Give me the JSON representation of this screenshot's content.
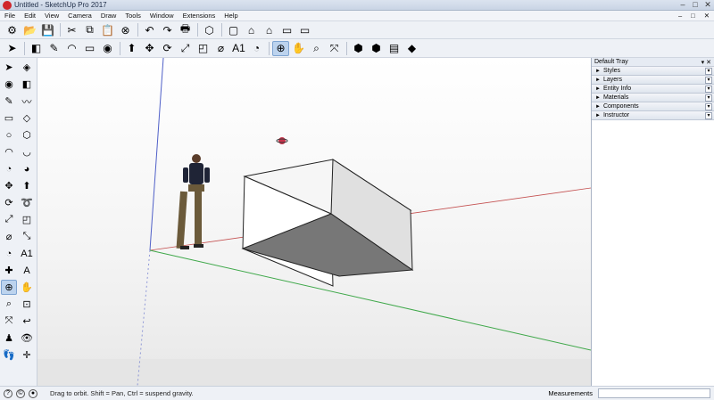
{
  "window": {
    "title": "Untitled - SketchUp Pro 2017",
    "minimize": "–",
    "maximize": "□",
    "close": "✕"
  },
  "menu": [
    "File",
    "Edit",
    "View",
    "Camera",
    "Draw",
    "Tools",
    "Window",
    "Extensions",
    "Help"
  ],
  "menu_right": [
    "–",
    "□",
    "✕"
  ],
  "toolbar1": [
    {
      "name": "getting-started-icon",
      "glyph": "⚙"
    },
    {
      "name": "open-icon",
      "glyph": "📂"
    },
    {
      "name": "save-icon",
      "glyph": "💾"
    },
    {
      "name": "cut-icon",
      "glyph": "✂"
    },
    {
      "name": "copy-icon",
      "glyph": "⧉"
    },
    {
      "name": "paste-icon",
      "glyph": "📋"
    },
    {
      "name": "erase-icon",
      "glyph": "⊗"
    },
    {
      "name": "undo-icon",
      "glyph": "↶"
    },
    {
      "name": "redo-icon",
      "glyph": "↷"
    },
    {
      "name": "print-icon",
      "glyph": "🖶"
    },
    {
      "name": "model-info-icon",
      "glyph": "⬡"
    },
    {
      "name": "iso-view-icon",
      "glyph": "▢"
    },
    {
      "name": "home-icon",
      "glyph": "⌂"
    },
    {
      "name": "front-view-icon",
      "glyph": "⌂"
    },
    {
      "name": "right-view-icon",
      "glyph": "▭"
    },
    {
      "name": "back-view-icon",
      "glyph": "▭"
    }
  ],
  "toolbar2": [
    {
      "name": "select-icon",
      "glyph": "➤"
    },
    {
      "name": "eraser-icon",
      "glyph": "◧"
    },
    {
      "name": "line-icon",
      "glyph": "✎"
    },
    {
      "name": "arc-icon",
      "glyph": "◠"
    },
    {
      "name": "rectangle-icon",
      "glyph": "▭"
    },
    {
      "name": "paint-bucket-icon",
      "glyph": "◉"
    },
    {
      "name": "push-pull-icon",
      "glyph": "⬆"
    },
    {
      "name": "move-icon",
      "glyph": "✥"
    },
    {
      "name": "rotate-icon",
      "glyph": "⟳"
    },
    {
      "name": "scale-icon",
      "glyph": "⤢"
    },
    {
      "name": "offset-icon",
      "glyph": "◰"
    },
    {
      "name": "tape-measure-icon",
      "glyph": "⌀"
    },
    {
      "name": "text-icon",
      "glyph": "A1"
    },
    {
      "name": "protractor-icon",
      "glyph": "◔"
    },
    {
      "name": "orbit-icon",
      "glyph": "⊕"
    },
    {
      "name": "pan-icon",
      "glyph": "✋"
    },
    {
      "name": "zoom-icon",
      "glyph": "⌕"
    },
    {
      "name": "zoom-extents-icon",
      "glyph": "⤧"
    },
    {
      "name": "3d-warehouse-icon",
      "glyph": "⬢"
    },
    {
      "name": "extension-warehouse-icon",
      "glyph": "⬢"
    },
    {
      "name": "layout-icon",
      "glyph": "▤"
    },
    {
      "name": "ruby-console-icon",
      "glyph": "◆"
    }
  ],
  "left_tools": [
    {
      "name": "select-icon",
      "glyph": "➤"
    },
    {
      "name": "make-component-icon",
      "glyph": "◈"
    },
    {
      "name": "paint-bucket-icon",
      "glyph": "◉"
    },
    {
      "name": "eraser-icon",
      "glyph": "◧"
    },
    {
      "name": "line-icon",
      "glyph": "✎"
    },
    {
      "name": "freehand-icon",
      "glyph": "〰"
    },
    {
      "name": "rectangle-icon",
      "glyph": "▭"
    },
    {
      "name": "rotated-rectangle-icon",
      "glyph": "◇"
    },
    {
      "name": "circle-icon",
      "glyph": "○"
    },
    {
      "name": "polygon-icon",
      "glyph": "⬡"
    },
    {
      "name": "arc-icon",
      "glyph": "◠"
    },
    {
      "name": "two-point-arc-icon",
      "glyph": "◡"
    },
    {
      "name": "three-point-arc-icon",
      "glyph": "◔"
    },
    {
      "name": "pie-icon",
      "glyph": "◕"
    },
    {
      "name": "move-icon",
      "glyph": "✥"
    },
    {
      "name": "push-pull-icon",
      "glyph": "⬆"
    },
    {
      "name": "rotate-icon",
      "glyph": "⟳"
    },
    {
      "name": "follow-me-icon",
      "glyph": "➰"
    },
    {
      "name": "scale-icon",
      "glyph": "⤢"
    },
    {
      "name": "offset-icon",
      "glyph": "◰"
    },
    {
      "name": "tape-measure-icon",
      "glyph": "⌀"
    },
    {
      "name": "dimension-icon",
      "glyph": "⤡"
    },
    {
      "name": "protractor-icon",
      "glyph": "◔"
    },
    {
      "name": "text-icon",
      "glyph": "A1"
    },
    {
      "name": "axes-icon",
      "glyph": "✚"
    },
    {
      "name": "3d-text-icon",
      "glyph": "A"
    },
    {
      "name": "orbit-icon",
      "glyph": "⊕"
    },
    {
      "name": "pan-icon",
      "glyph": "✋"
    },
    {
      "name": "zoom-icon",
      "glyph": "⌕"
    },
    {
      "name": "zoom-window-icon",
      "glyph": "⊡"
    },
    {
      "name": "zoom-extents-icon",
      "glyph": "⤧"
    },
    {
      "name": "previous-view-icon",
      "glyph": "↩"
    },
    {
      "name": "position-camera-icon",
      "glyph": "♟"
    },
    {
      "name": "look-around-icon",
      "glyph": "👁"
    },
    {
      "name": "walk-icon",
      "glyph": "👣"
    },
    {
      "name": "section-plane-icon",
      "glyph": "✛"
    }
  ],
  "tray": {
    "title": "Default Tray",
    "controls": "▾ ✕",
    "panels": [
      "Styles",
      "Layers",
      "Entity Info",
      "Materials",
      "Components",
      "Instructor"
    ]
  },
  "status": {
    "hint": "Drag to orbit. Shift = Pan, Ctrl = suspend gravity.",
    "measurements_label": "Measurements",
    "measurements_value": ""
  },
  "colors": {
    "x_axis": "#c45050",
    "y_axis": "#3fa84a",
    "z_axis": "#5060c8",
    "accent": "#d0262b"
  }
}
